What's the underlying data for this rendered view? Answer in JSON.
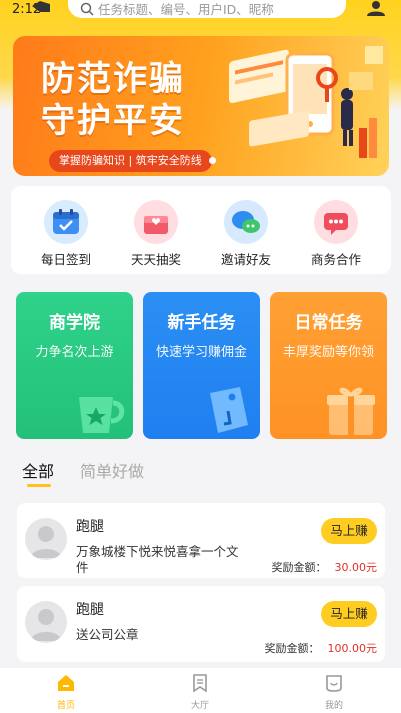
{
  "status": {
    "time": "2:12"
  },
  "search": {
    "placeholder": "任务标题、编号、用户ID、昵称"
  },
  "banner": {
    "title_line1": "防范诈骗",
    "title_line2": "守护平安",
    "pill_text": "掌握防骗知识 | 筑牢安全防线"
  },
  "quick": [
    {
      "label": "每日签到",
      "icon": "calendar-icon",
      "color": "#3d8ef5"
    },
    {
      "label": "天天抽奖",
      "icon": "gift-box-icon",
      "color": "#f25a6a"
    },
    {
      "label": "邀请好友",
      "icon": "chat-bubble-icon",
      "color": "#2e8df0"
    },
    {
      "label": "商务合作",
      "icon": "message-icon",
      "color": "#f04d5c"
    }
  ],
  "features": [
    {
      "title": "商学院",
      "subtitle": "力争名次上游",
      "color": "#2fd28a"
    },
    {
      "title": "新手任务",
      "subtitle": "快速学习赚佣金",
      "color": "#2b8ff4"
    },
    {
      "title": "日常任务",
      "subtitle": "丰厚奖励等你领",
      "color": "#ff9d2a"
    }
  ],
  "tabs": {
    "all": "全部",
    "easy": "简单好做"
  },
  "tasks": [
    {
      "title": "跑腿",
      "desc": "万象城楼下悦来悦喜拿一个文件",
      "button": "马上赚",
      "reward_label": "奖励金额：",
      "reward_amount": "30.00元"
    },
    {
      "title": "跑腿",
      "desc": "送公司公章",
      "button": "马上赚",
      "reward_label": "奖励金额：",
      "reward_amount": "100.00元"
    }
  ],
  "nav": {
    "home": "首页",
    "hall": "大厅",
    "mine": "我的",
    "active_color": "#ffb800",
    "inactive_color": "#999999"
  }
}
